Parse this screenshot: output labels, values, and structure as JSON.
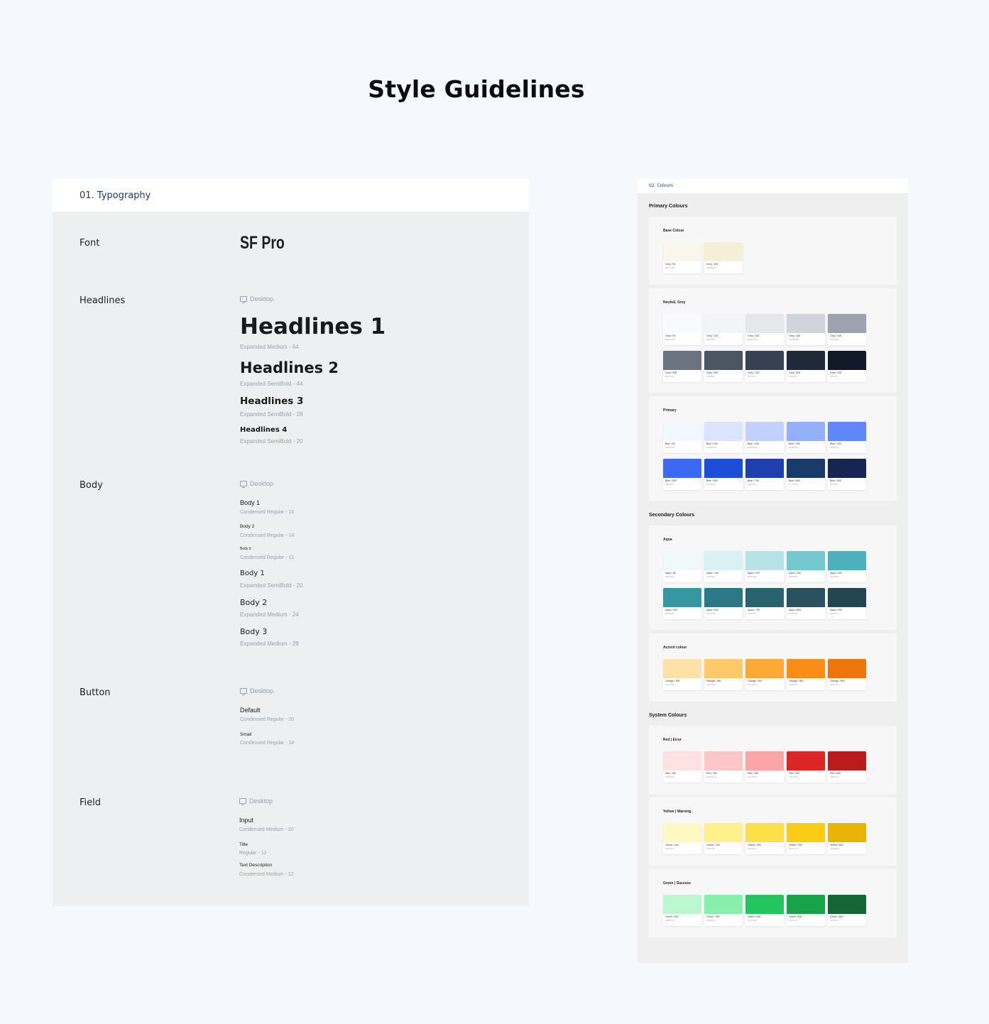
{
  "page": {
    "title": "Style Guidelines"
  },
  "typography": {
    "header": "01. Typography",
    "font": {
      "label": "Font",
      "value": "SF Pro"
    },
    "headlines": {
      "label": "Headlines",
      "device": "Desktop",
      "items": [
        {
          "text": "Headlines 1",
          "spec": "Expanded Medium - 64"
        },
        {
          "text": "Headlines 2",
          "spec": "Expanded SemiBold - 44"
        },
        {
          "text": "Headlines 3",
          "spec": "Expanded SemiBold - 28"
        },
        {
          "text": "Headlines 4",
          "spec": "Expanded SemiBold - 20"
        }
      ]
    },
    "body": {
      "label": "Body",
      "device": "Desktop",
      "items": [
        {
          "text": "Body 1",
          "spec": "Condensed Regular - 16"
        },
        {
          "text": "Body 2",
          "spec": "Condensed Regular - 14"
        },
        {
          "text": "Body 3",
          "spec": "Condensed Regular - 12"
        },
        {
          "text": "Body 1",
          "spec": "Expanded SemiBold - 20"
        },
        {
          "text": "Body 2",
          "spec": "Expanded Medium - 24"
        },
        {
          "text": "Body 3",
          "spec": "Expanded Medium - 28"
        }
      ]
    },
    "button": {
      "label": "Button",
      "device": "Desktop",
      "items": [
        {
          "text": "Default",
          "spec": "Condensed Regular - 20"
        },
        {
          "text": "Small",
          "spec": "Condensed Regular - 14"
        }
      ]
    },
    "field": {
      "label": "Field",
      "device": "Desktop",
      "items": [
        {
          "text": "Input",
          "spec": "Condensed Medium - 20"
        },
        {
          "text": "Title",
          "spec": "Regular - 12"
        },
        {
          "text": "Text Description",
          "spec": "Condensed Medium - 12"
        }
      ]
    }
  },
  "colours": {
    "header": "02. Colours",
    "sections": {
      "primary": "Primary Colours",
      "secondary": "Secondary Colours",
      "system": "System Colours"
    },
    "groups": [
      {
        "title": "Base Colour",
        "swatches": [
          {
            "name": "Ivory / 50",
            "hex": "#FAF7EE",
            "color": "#faf6ec"
          },
          {
            "name": "Ivory / 100",
            "hex": "#F5EED9",
            "color": "#f5efd9"
          }
        ]
      },
      {
        "title": "Neutral, Grey",
        "swatches": [
          {
            "name": "Grey / 50",
            "hex": "#F9FAFB",
            "color": "#f9fafb"
          },
          {
            "name": "Grey / 100",
            "hex": "#F3F4F6",
            "color": "#f3f4f6"
          },
          {
            "name": "Grey / 200",
            "hex": "#E5E7EB",
            "color": "#e5e7eb"
          },
          {
            "name": "Grey / 300",
            "hex": "#D1D5DB",
            "color": "#d1d5db"
          },
          {
            "name": "Grey / 400",
            "hex": "#9CA3AF",
            "color": "#9ca3af"
          },
          {
            "name": "Grey / 500",
            "hex": "#6B7280",
            "color": "#6b7280"
          },
          {
            "name": "Grey / 600",
            "hex": "#4B5563",
            "color": "#4b5563"
          },
          {
            "name": "Grey / 700",
            "hex": "#374151",
            "color": "#374151"
          },
          {
            "name": "Grey / 800",
            "hex": "#1F2937",
            "color": "#1f2937"
          },
          {
            "name": "Grey / 900",
            "hex": "#111827",
            "color": "#111827"
          }
        ]
      },
      {
        "title": "Primary",
        "swatches": [
          {
            "name": "Blue / 50",
            "hex": "#EFF6FF",
            "color": "#f2f6ff"
          },
          {
            "name": "Blue / 100",
            "hex": "#DBE4FE",
            "color": "#dbe4fe"
          },
          {
            "name": "Blue / 200",
            "hex": "#C0D1FE",
            "color": "#c0d1fe"
          },
          {
            "name": "Blue / 300",
            "hex": "#93B0FB",
            "color": "#93b0fb"
          },
          {
            "name": "Blue / 400",
            "hex": "#6087F8",
            "color": "#6087f8"
          },
          {
            "name": "Blue / 500",
            "hex": "#3B69F4",
            "color": "#3b69f4"
          },
          {
            "name": "Blue / 600",
            "hex": "#1D4ED8",
            "color": "#1d4ed8"
          },
          {
            "name": "Blue / 700",
            "hex": "#1E40AF",
            "color": "#1e40af"
          },
          {
            "name": "Blue / 800",
            "hex": "#173C6B",
            "color": "#173c6b"
          },
          {
            "name": "Blue / 900",
            "hex": "#172554",
            "color": "#172554"
          }
        ]
      },
      {
        "title": "Aqua",
        "swatches": [
          {
            "name": "Aqua / 50",
            "hex": "#F0F9F9",
            "color": "#f0f9f8"
          },
          {
            "name": "Aqua / 100",
            "hex": "#D9F1F3",
            "color": "#d9f1f3"
          },
          {
            "name": "Aqua / 200",
            "hex": "#B7E3E6",
            "color": "#b7e3e6"
          },
          {
            "name": "Aqua / 300",
            "hex": "#76C8CF",
            "color": "#76c8cf"
          },
          {
            "name": "Aqua / 400",
            "hex": "#4DB0BC",
            "color": "#4db0bc"
          },
          {
            "name": "Aqua / 500",
            "hex": "#3696A2",
            "color": "#3696a2"
          },
          {
            "name": "Aqua / 600",
            "hex": "#2D7888",
            "color": "#2d7888"
          },
          {
            "name": "Aqua / 700",
            "hex": "#2A6370",
            "color": "#2a6370"
          },
          {
            "name": "Aqua / 800",
            "hex": "#27525E",
            "color": "#27525e"
          },
          {
            "name": "Aqua / 900",
            "hex": "#234550",
            "color": "#234550"
          }
        ]
      },
      {
        "title": "Accent colour",
        "swatches": [
          {
            "name": "Orange / 200",
            "hex": "#FEDFA6",
            "color": "#fee1a6"
          },
          {
            "name": "Orange / 300",
            "hex": "#FDC96B",
            "color": "#fdc96b"
          },
          {
            "name": "Orange / 400",
            "hex": "#FCA935",
            "color": "#fca935"
          },
          {
            "name": "Orange / 500",
            "hex": "#F98D16",
            "color": "#f98d16"
          },
          {
            "name": "Orange / 600",
            "hex": "#EE740C",
            "color": "#ee740c"
          }
        ]
      },
      {
        "title": "Red | Error",
        "swatches": [
          {
            "name": "Red / 100",
            "hex": "#FEE2E2",
            "color": "#fee2e2"
          },
          {
            "name": "Red / 200",
            "hex": "#FECACA",
            "color": "#fec6c6"
          },
          {
            "name": "Red / 300",
            "hex": "#FCA5A5",
            "color": "#fca5a5"
          },
          {
            "name": "Red / 400",
            "hex": "#DC2626",
            "color": "#dc2626"
          },
          {
            "name": "Red / 500",
            "hex": "#B91C1C",
            "color": "#b91c1c"
          }
        ]
      },
      {
        "title": "Yellow | Warning",
        "swatches": [
          {
            "name": "Yellow / 100",
            "hex": "#FEF9C3",
            "color": "#fef9c3"
          },
          {
            "name": "Yellow / 200",
            "hex": "#FEF08A",
            "color": "#fef08a"
          },
          {
            "name": "Yellow / 300",
            "hex": "#FDE047",
            "color": "#fde047"
          },
          {
            "name": "Yellow / 400",
            "hex": "#FACC15",
            "color": "#facc15"
          },
          {
            "name": "Yellow / 500",
            "hex": "#EAB308",
            "color": "#eab308"
          }
        ]
      },
      {
        "title": "Green | Success",
        "swatches": [
          {
            "name": "Green / 200",
            "hex": "#BBF7D0",
            "color": "#bbf7d0"
          },
          {
            "name": "Green / 300",
            "hex": "#86EFAC",
            "color": "#86efac"
          },
          {
            "name": "Green / 400",
            "hex": "#22C55E",
            "color": "#22c55e"
          },
          {
            "name": "Green / 500",
            "hex": "#16A34A",
            "color": "#16a34a"
          },
          {
            "name": "Green / 600",
            "hex": "#166534",
            "color": "#166534"
          }
        ]
      }
    ]
  }
}
